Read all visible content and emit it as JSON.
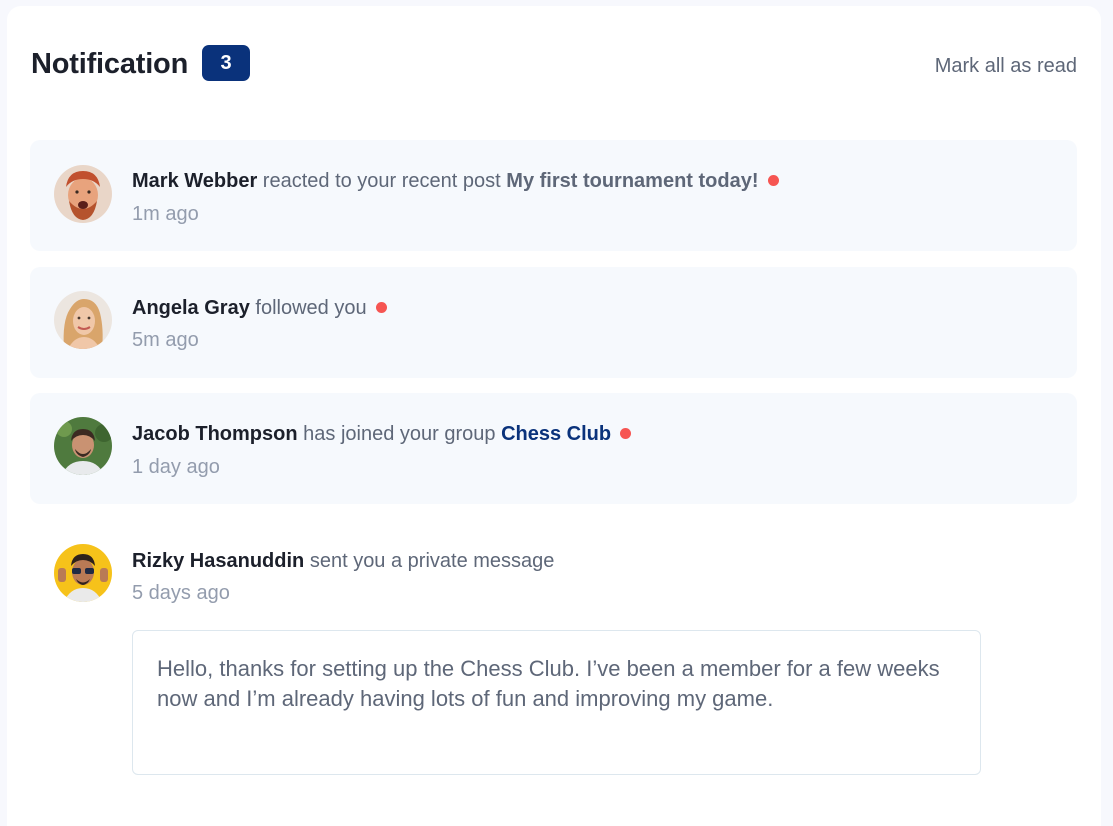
{
  "header": {
    "title": "Notification",
    "unread_count": "3",
    "mark_all_label": "Mark all as read"
  },
  "notifications": [
    {
      "name": "Mark Webber",
      "action": "reacted to your recent post",
      "target": "My first tournament today!",
      "time": "1m ago",
      "unread": true
    },
    {
      "name": "Angela Gray",
      "action": "followed you",
      "time": "5m ago",
      "unread": true
    },
    {
      "name": "Jacob Thompson",
      "action": "has joined your group",
      "target": "Chess Club",
      "time": "1 day ago",
      "unread": true
    },
    {
      "name": "Rizky Hasanuddin",
      "action": "sent you a private message",
      "time": "5 days ago",
      "unread": false,
      "message": "Hello, thanks for setting up the Chess Club. I’ve been a member for a few weeks now and I’m already having lots of fun and improving my game."
    }
  ],
  "colors": {
    "accent": "#0a327b",
    "unread_dot": "#f65552",
    "unread_bg": "#f6f9fd"
  }
}
